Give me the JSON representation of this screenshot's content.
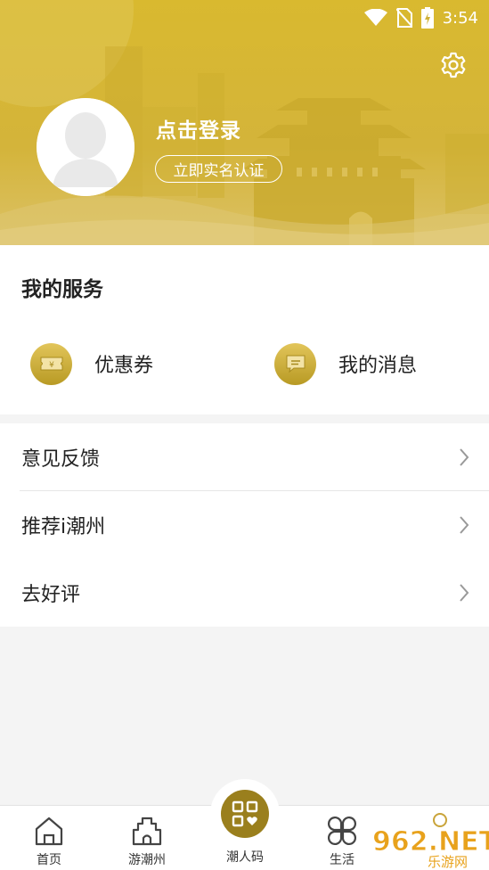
{
  "status_bar": {
    "time": "3:54",
    "icons": [
      "wifi-icon",
      "no-sim-icon",
      "battery-charging-icon"
    ]
  },
  "header": {
    "login_text": "点击登录",
    "verify_button": "立即实名认证",
    "settings_icon": "gear-icon",
    "accent_color": "#d6b63a"
  },
  "services": {
    "title": "我的服务",
    "items": [
      {
        "label": "优惠券",
        "icon": "coupon-ticket-icon"
      },
      {
        "label": "我的消息",
        "icon": "message-bubble-icon"
      }
    ]
  },
  "menu": {
    "items": [
      {
        "label": "意见反馈"
      },
      {
        "label": "推荐i潮州"
      },
      {
        "label": "去好评"
      }
    ]
  },
  "tabbar": {
    "tabs": [
      {
        "label": "首页",
        "icon": "home-icon"
      },
      {
        "label": "游潮州",
        "icon": "tower-icon"
      },
      {
        "label": "潮人码",
        "icon": "qr-code-icon"
      },
      {
        "label": "生活",
        "icon": "grid-clover-icon"
      }
    ],
    "center_color": "#9a7f1d"
  },
  "watermark": {
    "text": "962.NET",
    "subtext": "乐游网"
  }
}
